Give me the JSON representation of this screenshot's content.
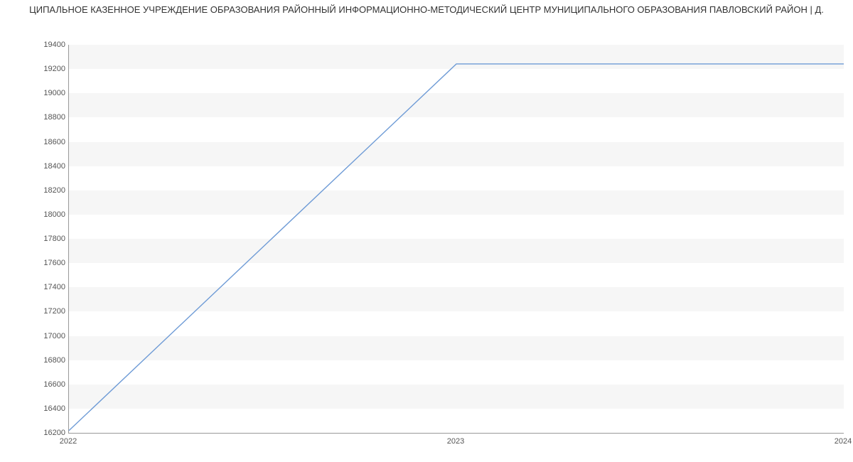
{
  "title": "ЦИПАЛЬНОЕ КАЗЕННОЕ УЧРЕЖДЕНИЕ ОБРАЗОВАНИЯ РАЙОННЫЙ ИНФОРМАЦИОННО-МЕТОДИЧЕСКИЙ ЦЕНТР МУНИЦИПАЛЬНОГО ОБРАЗОВАНИЯ ПАВЛОВСКИЙ РАЙОН | Д.",
  "chart_data": {
    "type": "line",
    "title": "ЦИПАЛЬНОЕ КАЗЕННОЕ УЧРЕЖДЕНИЕ ОБРАЗОВАНИЯ РАЙОННЫЙ ИНФОРМАЦИОННО-МЕТОДИЧЕСКИЙ ЦЕНТР МУНИЦИПАЛЬНОГО ОБРАЗОВАНИЯ ПАВЛОВСКИЙ РАЙОН | Д.",
    "xlabel": "",
    "ylabel": "",
    "x": [
      2022,
      2023,
      2024
    ],
    "series": [
      {
        "name": "value",
        "values": [
          16219,
          19242,
          19242
        ]
      }
    ],
    "ylim": [
      16200,
      19400
    ],
    "yticks": [
      16200,
      16400,
      16600,
      16800,
      17000,
      17200,
      17400,
      17600,
      17800,
      18000,
      18200,
      18400,
      18600,
      18800,
      19000,
      19200,
      19400
    ],
    "xticks": [
      2022,
      2023,
      2024
    ],
    "colors": {
      "line": "#6e9bd6",
      "grid_band": "#f6f6f6"
    }
  }
}
